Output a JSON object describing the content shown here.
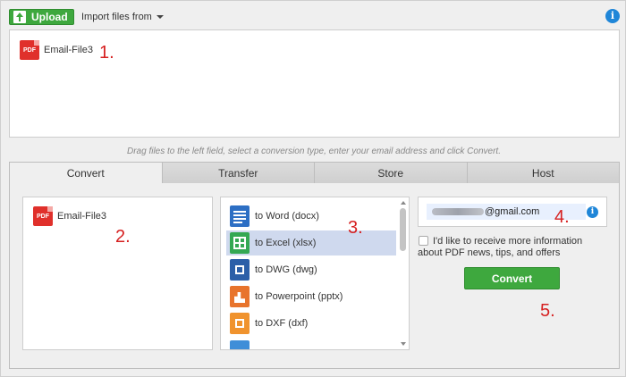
{
  "toolbar": {
    "upload_label": "Upload",
    "import_label": "Import files from"
  },
  "drop_area": {
    "files": [
      {
        "name": "Email-File3",
        "type_badge": "PDF"
      }
    ]
  },
  "hint": "Drag files to the left field, select a conversion type, enter your email address and click Convert.",
  "tabs": [
    {
      "label": "Convert",
      "active": true
    },
    {
      "label": "Transfer",
      "active": false
    },
    {
      "label": "Store",
      "active": false
    },
    {
      "label": "Host",
      "active": false
    }
  ],
  "left_panel": {
    "file_name": "Email-File3",
    "type_badge": "PDF"
  },
  "conversions": [
    {
      "label": "to Word (docx)",
      "icon": "word-icon",
      "selected": false
    },
    {
      "label": "to Excel (xlsx)",
      "icon": "excel-icon",
      "selected": true
    },
    {
      "label": "to DWG (dwg)",
      "icon": "dwg-icon",
      "selected": false
    },
    {
      "label": "to Powerpoint (pptx)",
      "icon": "powerpoint-icon",
      "selected": false
    },
    {
      "label": "to DXF (dxf)",
      "icon": "dxf-icon",
      "selected": false
    }
  ],
  "email": {
    "visible_suffix": "@gmail.com"
  },
  "newsletter": {
    "line1": "I'd like to receive more information",
    "line2": "about PDF news, tips, and offers",
    "checked": false
  },
  "convert_label": "Convert",
  "annotations": [
    "1.",
    "2.",
    "3.",
    "4.",
    "5."
  ],
  "colors": {
    "accent_green": "#3ea83e",
    "info_blue": "#1f86d8",
    "pdf_red": "#e0302b",
    "annotation_red": "#d62020",
    "selection": "#cfd9ee"
  }
}
